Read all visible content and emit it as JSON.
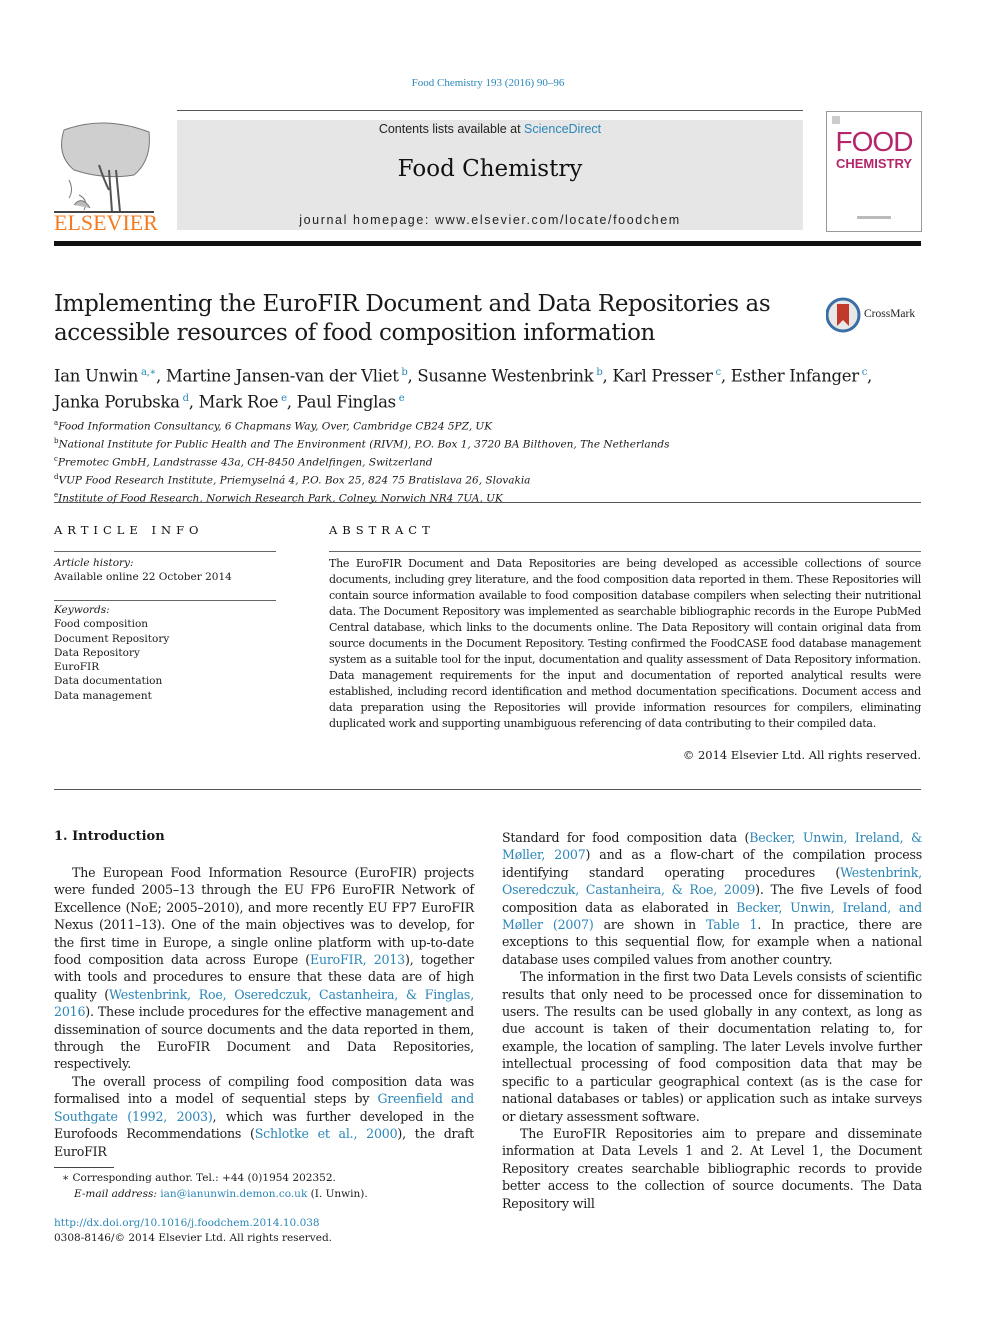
{
  "header": {
    "journal_ref": "Food Chemistry 193 (2016) 90–96",
    "contents_prefix": "Contents lists available at ",
    "contents_link": "ScienceDirect",
    "journal_title": "Food Chemistry",
    "homepage": "journal homepage: www.elsevier.com/locate/foodchem",
    "publisher_logo": "ELSEVIER",
    "cover_line1": "FOOD",
    "cover_line2": "CHEMISTRY",
    "brand_color": "#f47c20",
    "link_color": "#2a86b8",
    "cover_color": "#b5256a"
  },
  "article": {
    "title": "Implementing the EuroFIR Document and Data Repositories as accessible resources of food composition information",
    "crossmark_label": "CrossMark",
    "authors": [
      {
        "name": "Ian Unwin",
        "aff": "a,∗"
      },
      {
        "name": "Martine Jansen-van der Vliet",
        "aff": "b"
      },
      {
        "name": "Susanne Westenbrink",
        "aff": "b"
      },
      {
        "name": "Karl Presser",
        "aff": "c"
      },
      {
        "name": "Esther Infanger",
        "aff": "c"
      },
      {
        "name": "Janka Porubska",
        "aff": "d"
      },
      {
        "name": "Mark Roe",
        "aff": "e"
      },
      {
        "name": "Paul Finglas",
        "aff": "e"
      }
    ],
    "affiliations": [
      {
        "key": "a",
        "text": "Food Information Consultancy, 6 Chapmans Way, Over, Cambridge CB24 5PZ, UK"
      },
      {
        "key": "b",
        "text": "National Institute for Public Health and The Environment (RIVM), P.O. Box 1, 3720 BA Bilthoven, The Netherlands"
      },
      {
        "key": "c",
        "text": "Premotec GmbH, Landstrasse 43a, CH-8450 Andelfingen, Switzerland"
      },
      {
        "key": "d",
        "text": "VUP Food Research Institute, Priemyselná 4, P.O. Box 25, 824 75 Bratislava 26, Slovakia"
      },
      {
        "key": "e",
        "text": "Institute of Food Research, Norwich Research Park, Colney, Norwich NR4 7UA, UK"
      }
    ]
  },
  "article_info": {
    "heading": "ARTICLE INFO",
    "history_label": "Article history:",
    "history_value": "Available online 22 October 2014",
    "keywords_label": "Keywords:",
    "keywords": [
      "Food composition",
      "Document Repository",
      "Data Repository",
      "EuroFIR",
      "Data documentation",
      "Data management"
    ]
  },
  "abstract": {
    "heading": "ABSTRACT",
    "text": "The EuroFIR Document and Data Repositories are being developed as accessible collections of source documents, including grey literature, and the food composition data reported in them. These Repositories will contain source information available to food composition database compilers when selecting their nutritional data. The Document Repository was implemented as searchable bibliographic records in the Europe PubMed Central database, which links to the documents online. The Data Repository will contain original data from source documents in the Document Repository. Testing confirmed the FoodCASE food database management system as a suitable tool for the input, documentation and quality assessment of Data Repository information. Data management requirements for the input and documentation of reported analytical results were established, including record identification and method documentation specifications. Document access and data preparation using the Repositories will provide information resources for compilers, eliminating duplicated work and supporting unambiguous referencing of data contributing to their compiled data.",
    "copyright": "© 2014 Elsevier Ltd. All rights reserved."
  },
  "body": {
    "section_title": "1. Introduction",
    "left_p1": [
      {
        "t": "The European Food Information Resource (EuroFIR) projects were funded 2005–13 through the EU FP6 EuroFIR Network of Excellence (NoE; 2005–2010), and more recently EU FP7 EuroFIR Nexus (2011–13). One of the main objectives was to develop, for the first time in Europe, a single online platform with up-to-date food composition data across Europe ("
      },
      {
        "link": "EuroFIR, 2013"
      },
      {
        "t": "), together with tools and procedures to ensure that these data are of high quality ("
      },
      {
        "link": "Westenbrink, Roe, Oseredczuk, Castanheira, & Finglas, 2016"
      },
      {
        "t": "). These include procedures for the effective management and dissemination of source documents and the data reported in them, through the EuroFIR Document and Data Repositories, respectively."
      }
    ],
    "left_p2": [
      {
        "t": "The overall process of compiling food composition data was formalised into a model of sequential steps by "
      },
      {
        "link": "Greenfield and Southgate (1992, 2003)"
      },
      {
        "t": ", which was further developed in the Eurofoods Recommendations ("
      },
      {
        "link": "Schlotke et al., 2000"
      },
      {
        "t": "), the draft EuroFIR"
      }
    ],
    "right_p1": [
      {
        "t": "Standard for food composition data ("
      },
      {
        "link": "Becker, Unwin, Ireland, & Møller, 2007"
      },
      {
        "t": ") and as a flow-chart of the compilation process identifying standard operating procedures ("
      },
      {
        "link": "Westenbrink, Oseredczuk, Castanheira, & Roe, 2009"
      },
      {
        "t": "). The five Levels of food composition data as elaborated in "
      },
      {
        "link": "Becker, Unwin, Ireland, and Møller (2007)"
      },
      {
        "t": " are shown in "
      },
      {
        "link": "Table 1"
      },
      {
        "t": ". In practice, there are exceptions to this sequential flow, for example when a national database uses compiled values from another country."
      }
    ],
    "right_p2": "The information in the first two Data Levels consists of scientific results that only need to be processed once for dissemination to users. The results can be used globally in any context, as long as due account is taken of their documentation relating to, for example, the location of sampling. The later Levels involve further intellectual processing of food composition data that may be specific to a particular geographical context (as is the case for national databases or tables) or application such as intake surveys or dietary assessment software.",
    "right_p3": "The EuroFIR Repositories aim to prepare and disseminate information at Data Levels 1 and 2. At Level 1, the Document Repository creates searchable bibliographic records to provide better access to the collection of source documents. The Data Repository will"
  },
  "footnotes": {
    "corresponding": "∗ Corresponding author. Tel.: +44 (0)1954 202352.",
    "email_label": "E-mail address: ",
    "email": "ian@ianunwin.demon.co.uk",
    "email_suffix": " (I. Unwin).",
    "doi": "http://dx.doi.org/10.1016/j.foodchem.2014.10.038",
    "issn": "0308-8146/© 2014 Elsevier Ltd. All rights reserved."
  }
}
